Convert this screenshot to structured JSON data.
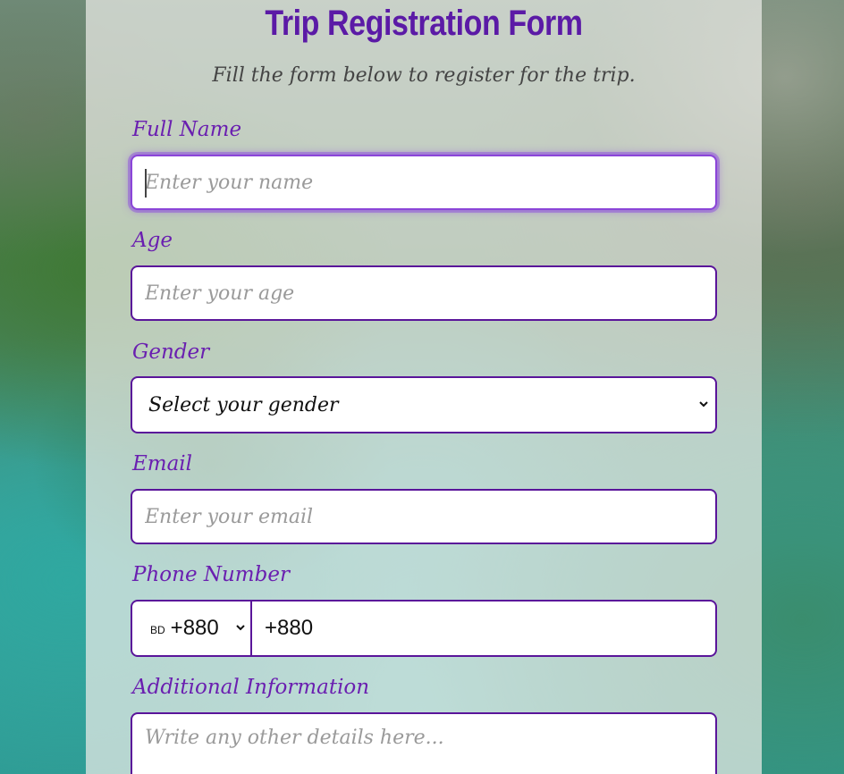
{
  "form": {
    "title": "Trip Registration Form",
    "subtitle": "Fill the form below to register for the trip.",
    "fields": {
      "full_name": {
        "label": "Full Name",
        "placeholder": "Enter your name",
        "value": ""
      },
      "age": {
        "label": "Age",
        "placeholder": "Enter your age",
        "value": ""
      },
      "gender": {
        "label": "Gender",
        "selected": "Select your gender"
      },
      "email": {
        "label": "Email",
        "placeholder": "Enter your email",
        "value": ""
      },
      "phone": {
        "label": "Phone Number",
        "country_code_abbr": "BD",
        "country_dial": "+880",
        "value": "+880"
      },
      "additional": {
        "label": "Additional Information",
        "placeholder": "Write any other details here..."
      }
    }
  },
  "colors": {
    "accent": "#6a1fb0",
    "border": "#5a159a",
    "focus_glow": "#8b45d8"
  },
  "icons": {
    "gender_dropdown": "chevron-down-icon",
    "country_dropdown": "chevron-down-icon"
  }
}
